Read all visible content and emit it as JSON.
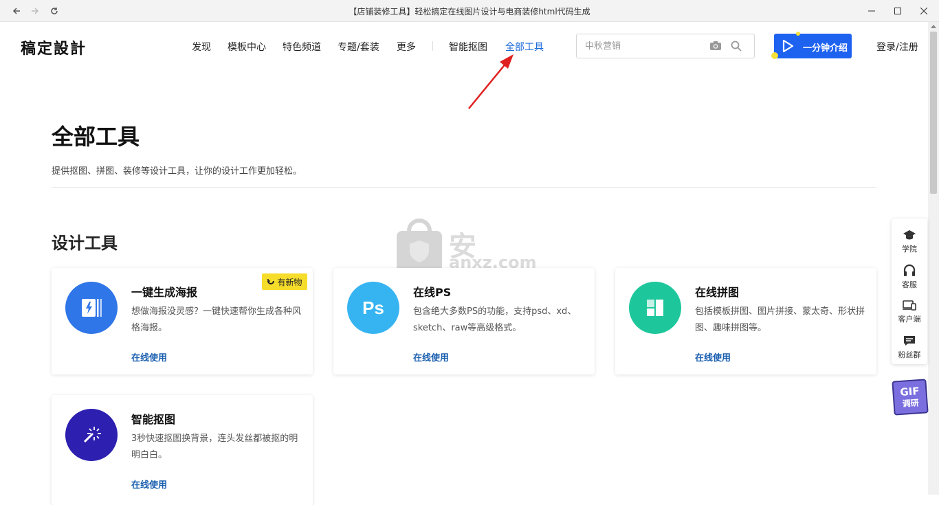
{
  "window": {
    "title": "【店铺装修工具】轻松搞定在线图片设计与电商装修html代码生成"
  },
  "header": {
    "logo": "稿定設計",
    "nav": [
      {
        "label": "发现",
        "active": false
      },
      {
        "label": "模板中心",
        "active": false
      },
      {
        "label": "特色频道",
        "active": false
      },
      {
        "label": "专题/套装",
        "active": false
      },
      {
        "label": "更多",
        "active": false
      },
      {
        "label": "智能抠图",
        "active": false
      },
      {
        "label": "全部工具",
        "active": true
      }
    ],
    "search_placeholder": "中秋营销",
    "promo_label": "一分钟介绍",
    "login_label": "登录/注册"
  },
  "main": {
    "title": "全部工具",
    "description": "提供抠图、拼图、装修等设计工具，让你的设计工作更加轻松。",
    "section_title": "设计工具",
    "cards": [
      {
        "title": "一键生成海报",
        "description": "想做海报没灵感？一键快速帮你生成各种风格海报。",
        "link": "在线使用",
        "badge": "有新物",
        "icon": "poster-icon",
        "color": "#2f76e8"
      },
      {
        "title": "在线PS",
        "description": "包含绝大多数PS的功能，支持psd、xd、sketch、raw等高级格式。",
        "link": "在线使用",
        "icon_text": "Ps",
        "icon": "ps-icon",
        "color": "#36b4f2"
      },
      {
        "title": "在线拼图",
        "description": "包括模板拼图、图片拼接、蒙太奇、形状拼图、趣味拼图等。",
        "link": "在线使用",
        "icon": "collage-icon",
        "color": "#1dc79b"
      },
      {
        "title": "智能抠图",
        "description": "3秒快速抠图换背景，连头发丝都被抠的明明白白。",
        "link": "在线使用",
        "icon": "magic-wand-icon",
        "color": "#2d1fb0"
      }
    ]
  },
  "watermark": {
    "text": "安下载",
    "sub": "anxz.com"
  },
  "float_menu": [
    {
      "label": "学院",
      "icon": "graduation-cap-icon"
    },
    {
      "label": "客服",
      "icon": "headset-icon"
    },
    {
      "label": "客户端",
      "icon": "devices-icon"
    },
    {
      "label": "粉丝群",
      "icon": "chat-icon"
    }
  ],
  "gif_badge": {
    "line1": "GIF",
    "line2": "调研"
  }
}
